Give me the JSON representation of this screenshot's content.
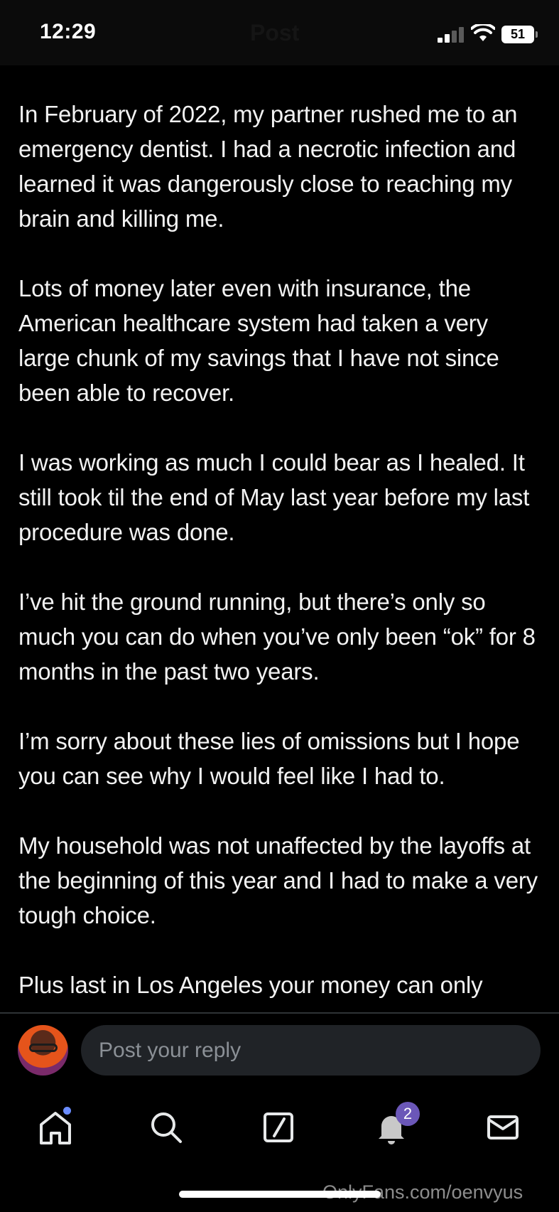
{
  "status_bar": {
    "time": "12:29",
    "battery": "51",
    "header_title_ghost": "Post"
  },
  "post": {
    "paragraphs": [
      "In February of 2022, my partner rushed me to an emergency dentist. I had a necrotic infection and learned it was dangerously close to reaching my brain and killing me.",
      "Lots of money later even with insurance, the American healthcare system had taken a very large chunk of my savings that I have not since been able to recover.",
      "I was working as much I could bear as I healed. It still took til the end of May last year before my last procedure was done.",
      "I’ve hit the ground running, but there’s only so much you can do when you’ve only been “ok” for 8 months in the past two years.",
      "I’m sorry about these lies of omissions but I hope you can see why I would feel like I had to.",
      "My household was not unaffected by the layoffs at the beginning of this year and I had to make a very tough choice.",
      "Plus last in Los Angeles your money can only"
    ]
  },
  "reply": {
    "placeholder": "Post your reply"
  },
  "tab_bar": {
    "items": [
      {
        "icon": "home-icon"
      },
      {
        "icon": "search-icon"
      },
      {
        "icon": "compose-icon"
      },
      {
        "icon": "bell-icon",
        "badge": "2"
      },
      {
        "icon": "mail-icon"
      }
    ]
  },
  "watermark": "OnlyFans.com/oenvyus",
  "colors": {
    "background": "#000000",
    "text": "#f2f2f2",
    "input_bg": "#202327",
    "badge": "#6b57b8"
  }
}
